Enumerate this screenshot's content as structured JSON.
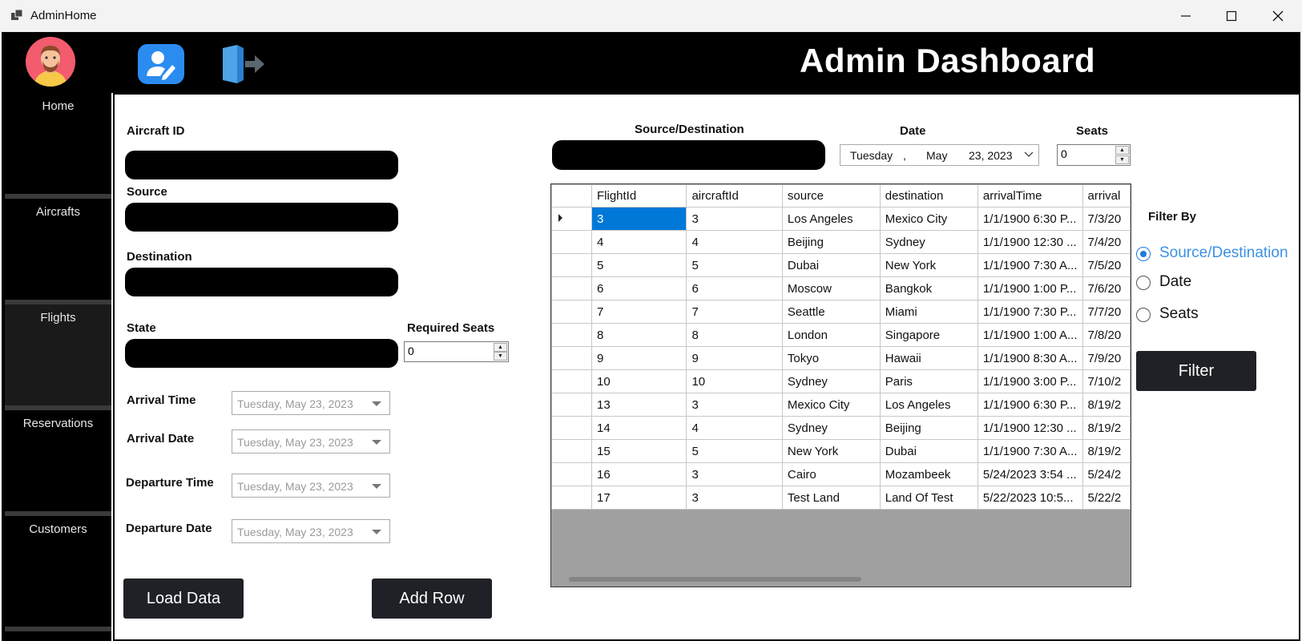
{
  "window": {
    "title": "AdminHome"
  },
  "header": {
    "title": "Admin Dashboard"
  },
  "sidebar": {
    "items": [
      {
        "label": "Home"
      },
      {
        "label": "Aircrafts"
      },
      {
        "label": "Flights"
      },
      {
        "label": "Reservations"
      },
      {
        "label": "Customers"
      }
    ]
  },
  "form": {
    "aircraft_id_label": "Aircraft ID",
    "source_label": "Source",
    "destination_label": "Destination",
    "state_label": "State",
    "required_seats_label": "Required Seats",
    "required_seats_value": "0",
    "arrival_time_label": "Arrival Time",
    "arrival_date_label": "Arrival Date",
    "departure_time_label": "Departure Time",
    "departure_date_label": "Departure Date",
    "date_value": "Tuesday, May 23, 2023",
    "load_button": "Load Data",
    "add_button": "Add Row"
  },
  "filter": {
    "srcdst_label": "Source/Destination",
    "date_label": "Date",
    "date_value": {
      "day": "Tuesday",
      "comma": ",",
      "month": "May",
      "daynum": "23, 2023"
    },
    "seats_label": "Seats",
    "seats_value": "0",
    "filter_by_label": "Filter By",
    "options": [
      {
        "label": "Source/Destination",
        "checked": true
      },
      {
        "label": "Date",
        "checked": false
      },
      {
        "label": "Seats",
        "checked": false
      }
    ],
    "filter_button": "Filter"
  },
  "grid": {
    "columns": [
      "FlightId",
      "aircraftId",
      "source",
      "destination",
      "arrivalTime",
      "arrival"
    ],
    "rows": [
      [
        "3",
        "3",
        "Los Angeles",
        "Mexico City",
        "1/1/1900 6:30 P...",
        "7/3/20"
      ],
      [
        "4",
        "4",
        "Beijing",
        "Sydney",
        "1/1/1900 12:30 ...",
        "7/4/20"
      ],
      [
        "5",
        "5",
        "Dubai",
        "New York",
        "1/1/1900 7:30 A...",
        "7/5/20"
      ],
      [
        "6",
        "6",
        "Moscow",
        "Bangkok",
        "1/1/1900 1:00 P...",
        "7/6/20"
      ],
      [
        "7",
        "7",
        "Seattle",
        "Miami",
        "1/1/1900 7:30 P...",
        "7/7/20"
      ],
      [
        "8",
        "8",
        "London",
        "Singapore",
        "1/1/1900 1:00 A...",
        "7/8/20"
      ],
      [
        "9",
        "9",
        "Tokyo",
        "Hawaii",
        "1/1/1900 8:30 A...",
        "7/9/20"
      ],
      [
        "10",
        "10",
        "Sydney",
        "Paris",
        "1/1/1900 3:00 P...",
        "7/10/2"
      ],
      [
        "13",
        "3",
        "Mexico City",
        "Los Angeles",
        "1/1/1900 6:30 P...",
        "8/19/2"
      ],
      [
        "14",
        "4",
        "Sydney",
        "Beijing",
        "1/1/1900 12:30 ...",
        "8/19/2"
      ],
      [
        "15",
        "5",
        "New York",
        "Dubai",
        "1/1/1900 7:30 A...",
        "8/19/2"
      ],
      [
        "16",
        "3",
        "Cairo",
        "Mozambeek",
        "5/24/2023 3:54 ...",
        "5/24/2"
      ],
      [
        "17",
        "3",
        "Test Land",
        "Land Of Test",
        "5/22/2023 10:5...",
        "5/22/2"
      ]
    ]
  }
}
